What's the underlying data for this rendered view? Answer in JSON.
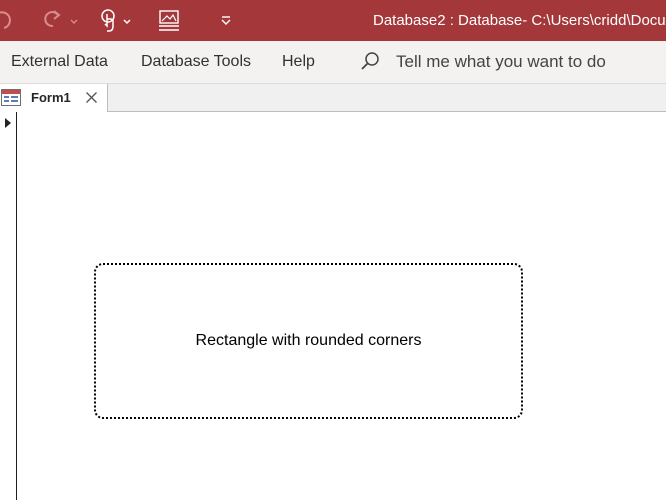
{
  "title_bar": {
    "title": "Database2 : Database- C:\\Users\\cridd\\Docum"
  },
  "quick_access": {
    "undo_icon": "undo-icon",
    "redo_icon": "redo-icon",
    "touch_mode_icon": "touch-mouse-mode-icon",
    "view_icon": "form-view-icon",
    "customize_icon": "customize-toolbar-icon"
  },
  "ribbon": {
    "tabs": [
      {
        "label": "External Data"
      },
      {
        "label": "Database Tools"
      },
      {
        "label": "Help"
      }
    ],
    "tell_me": "Tell me what you want to do"
  },
  "document_tabs": [
    {
      "label": "Form1",
      "icon": "form-icon",
      "active": true
    }
  ],
  "form": {
    "shapes": [
      {
        "type": "rectangle-rounded-corners",
        "label": "Rectangle with rounded corners"
      }
    ]
  },
  "colors": {
    "title_bar": "#a4373a",
    "ribbon_background": "#f3f2f1",
    "form_icon_accent": "#c0504d"
  }
}
